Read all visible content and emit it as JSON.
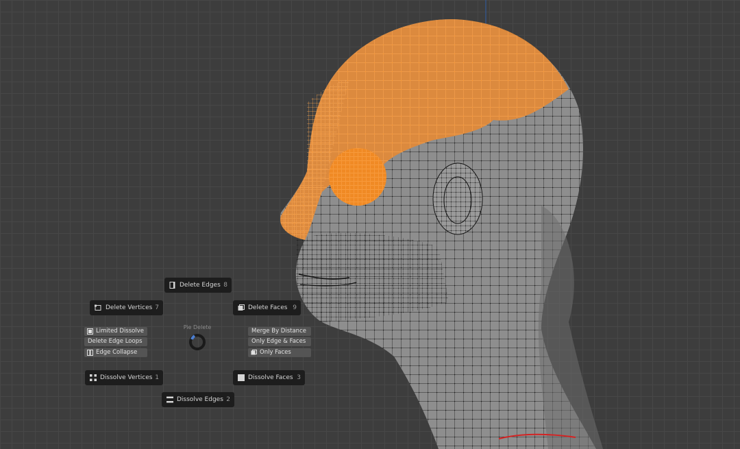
{
  "pie_menu": {
    "title": "Pie Delete",
    "delete_edges": {
      "label": "Delete Edges",
      "key": "8"
    },
    "delete_vertices": {
      "label": "Delete Vertices",
      "key": "7"
    },
    "delete_faces": {
      "label": "Delete Faces",
      "key": "9"
    },
    "dissolve_vertices": {
      "label": "Dissolve Vertices",
      "key": "1"
    },
    "dissolve_faces": {
      "label": "Dissolve Faces",
      "key": "3"
    },
    "dissolve_edges": {
      "label": "Dissolve Edges",
      "key": "2"
    },
    "left_column": [
      "Limited Dissolve",
      "Delete Edge Loops",
      "Edge Collapse"
    ],
    "right_column": [
      "Merge By Distance",
      "Only Edge & Faces",
      "Only Faces"
    ]
  },
  "colors": {
    "selection": "#f08a24",
    "mesh_gray": "#8c8c8c",
    "wire": "#111111",
    "viewport_bg": "#3d3d3d",
    "grid": "#474747",
    "axis_blue": "#2f5da8",
    "edge_red": "#d42222"
  },
  "icons": {
    "delete_edges": "edge-icon",
    "delete_vertices": "vertex-icon",
    "delete_faces": "face-icon",
    "dissolve_vertices": "dissolve-vertices-icon",
    "dissolve_faces": "dissolve-face-icon",
    "dissolve_edges": "dissolve-edges-icon",
    "pie_ring": "pie-direction-ring-icon"
  }
}
